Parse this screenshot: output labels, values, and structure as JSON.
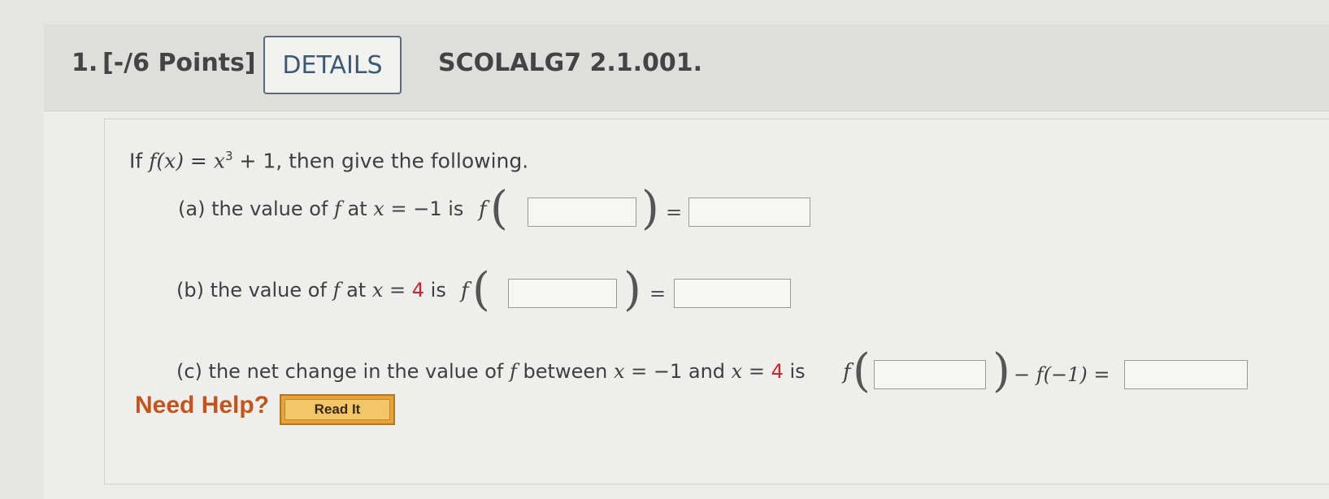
{
  "question": {
    "number": "1.",
    "points": "[-/6 Points]",
    "details_label": "DETAILS",
    "code": "SCOLALG7 2.1.001."
  },
  "statement": {
    "prefix": "If ",
    "fx": "f(x)",
    "eq": " = ",
    "x": "x",
    "exp": "3",
    "rest": " + 1,  then give the following."
  },
  "parts": {
    "a": {
      "label": "(a) the value of ",
      "f": "f",
      "at": " at ",
      "x_eq": "x = ",
      "value": "−1",
      "is": "  is"
    },
    "b": {
      "label": "(b) the value of ",
      "f": "f",
      "at": " at ",
      "x_eq": "x = ",
      "value": "4",
      "is": "  is"
    },
    "c": {
      "label": "(c) the net change in the value of ",
      "f": "f",
      "between": " between ",
      "x_eq1": "x = ",
      "value1": "−1",
      "and": "  and  ",
      "x_eq2": "x = ",
      "value2": "4",
      "is": "  is",
      "minus_term": "− f(−1) ="
    }
  },
  "symbols": {
    "f": "f",
    "lparen": "(",
    "rparen": ")",
    "equals": "="
  },
  "help": {
    "label": "Need Help?",
    "read_it": "Read It"
  }
}
